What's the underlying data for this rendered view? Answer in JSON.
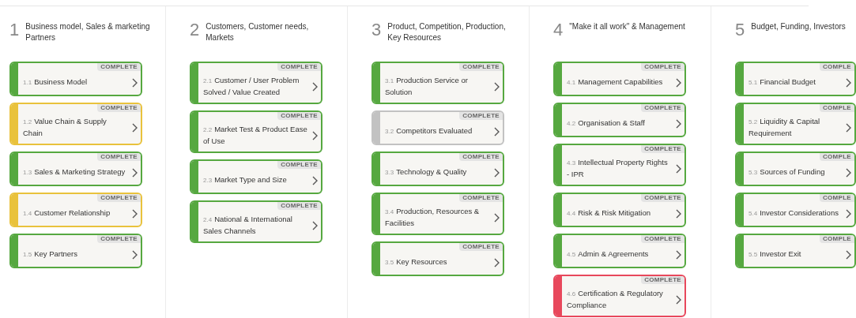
{
  "sections": [
    {
      "number": "1",
      "title": "Business model, Sales & marketing Partners",
      "cards": [
        {
          "number": "1.1",
          "title": "Business Model",
          "badge": "COMPLETE",
          "color": "#56a840"
        },
        {
          "number": "1.2",
          "title": "Value Chain & Supply Chain",
          "badge": "COMPLETE",
          "color": "#e9c23c"
        },
        {
          "number": "1.3",
          "title": "Sales & Marketing Strategy",
          "badge": "COMPLETE",
          "color": "#56a840"
        },
        {
          "number": "1.4",
          "title": "Customer Relationship",
          "badge": "COMPLETE",
          "color": "#e9c23c"
        },
        {
          "number": "1.5",
          "title": "Key Partners",
          "badge": "COMPLETE",
          "color": "#56a840"
        }
      ]
    },
    {
      "number": "2",
      "title": "Customers, Customer needs, Markets",
      "cards": [
        {
          "number": "2.1",
          "title": "Customer / User Problem Solved / Value Created",
          "badge": "COMPLETE",
          "color": "#56a840"
        },
        {
          "number": "2.2",
          "title": "Market Test & Product Ease of Use",
          "badge": "COMPLETE",
          "color": "#56a840"
        },
        {
          "number": "2.3",
          "title": "Market Type and Size",
          "badge": "COMPLETE",
          "color": "#56a840"
        },
        {
          "number": "2.4",
          "title": "National & International Sales Channels",
          "badge": "COMPLETE",
          "color": "#56a840"
        }
      ]
    },
    {
      "number": "3",
      "title": "Product, Competition, Production, Key Resources",
      "cards": [
        {
          "number": "3.1",
          "title": "Production Service or Solution",
          "badge": "COMPLETE",
          "color": "#56a840"
        },
        {
          "number": "3.2",
          "title": "Competitors Evaluated",
          "badge": "COMPLETE",
          "color": "#c2c2c2"
        },
        {
          "number": "3.3",
          "title": "Technology & Quality",
          "badge": "COMPLETE",
          "color": "#56a840"
        },
        {
          "number": "3.4",
          "title": "Production, Resources & Facilities",
          "badge": "COMPLETE",
          "color": "#56a840"
        },
        {
          "number": "3.5",
          "title": "Key Resources",
          "badge": "COMPLETE",
          "color": "#56a840"
        }
      ]
    },
    {
      "number": "4",
      "title": "\"Make it all work\" & Management",
      "cards": [
        {
          "number": "4.1",
          "title": "Management Capabilities",
          "badge": "COMPLETE",
          "color": "#56a840"
        },
        {
          "number": "4.2",
          "title": "Organisation & Staff",
          "badge": "COMPLETE",
          "color": "#56a840"
        },
        {
          "number": "4.3",
          "title": "Intellectual Property Rights - IPR",
          "badge": "COMPLETE",
          "color": "#56a840"
        },
        {
          "number": "4.4",
          "title": "Risk & Risk Mitigation",
          "badge": "COMPLETE",
          "color": "#56a840"
        },
        {
          "number": "4.5",
          "title": "Admin & Agreements",
          "badge": "COMPLETE",
          "color": "#56a840"
        },
        {
          "number": "4.6",
          "title": "Certification & Regulatory Compliance",
          "badge": "COMPLETE",
          "color": "#e8485c"
        }
      ]
    },
    {
      "number": "5",
      "title": "Budget, Funding, Investors",
      "cards": [
        {
          "number": "5.1",
          "title": "Financial Budget",
          "badge": "COMPLE",
          "color": "#56a840"
        },
        {
          "number": "5.2",
          "title": "Liquidity & Capital Requirement",
          "badge": "COMPLE",
          "color": "#56a840"
        },
        {
          "number": "5.3",
          "title": "Sources of Funding",
          "badge": "COMPLE",
          "color": "#56a840"
        },
        {
          "number": "5.4",
          "title": "Investor Considerations",
          "badge": "COMPLE",
          "color": "#56a840"
        },
        {
          "number": "5.5",
          "title": "Investor Exit",
          "badge": "COMPLE",
          "color": "#56a840"
        }
      ]
    }
  ]
}
